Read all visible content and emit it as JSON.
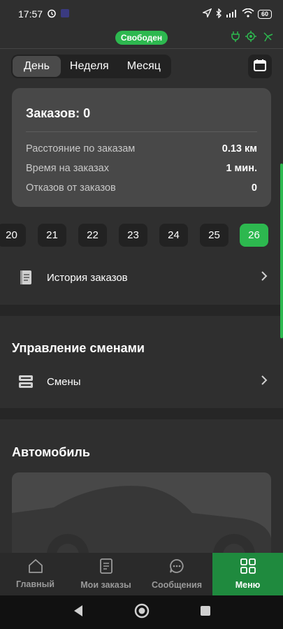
{
  "statusbar": {
    "time": "17:57",
    "battery": "60"
  },
  "top": {
    "status": "Свободен"
  },
  "period_tabs": [
    "День",
    "Неделя",
    "Месяц"
  ],
  "stats": {
    "title": "Заказов: 0",
    "rows": [
      {
        "label": "Расстояние по заказам",
        "value": "0.13 км"
      },
      {
        "label": "Время на заказах",
        "value": "1 мин."
      },
      {
        "label": "Отказов от заказов",
        "value": "0"
      }
    ]
  },
  "dates": [
    "20",
    "21",
    "22",
    "23",
    "24",
    "25",
    "26"
  ],
  "history": {
    "label": "История заказов"
  },
  "shifts": {
    "title": "Управление сменами",
    "item": "Смены"
  },
  "car": {
    "title": "Автомобиль"
  },
  "bottom_nav": [
    "Главный",
    "Мои заказы",
    "Сообщения",
    "Меню"
  ],
  "colors": {
    "accent": "#2db84f",
    "background": "#2f2f2f",
    "card": "#484848",
    "nav_active": "#1f8a3e"
  }
}
